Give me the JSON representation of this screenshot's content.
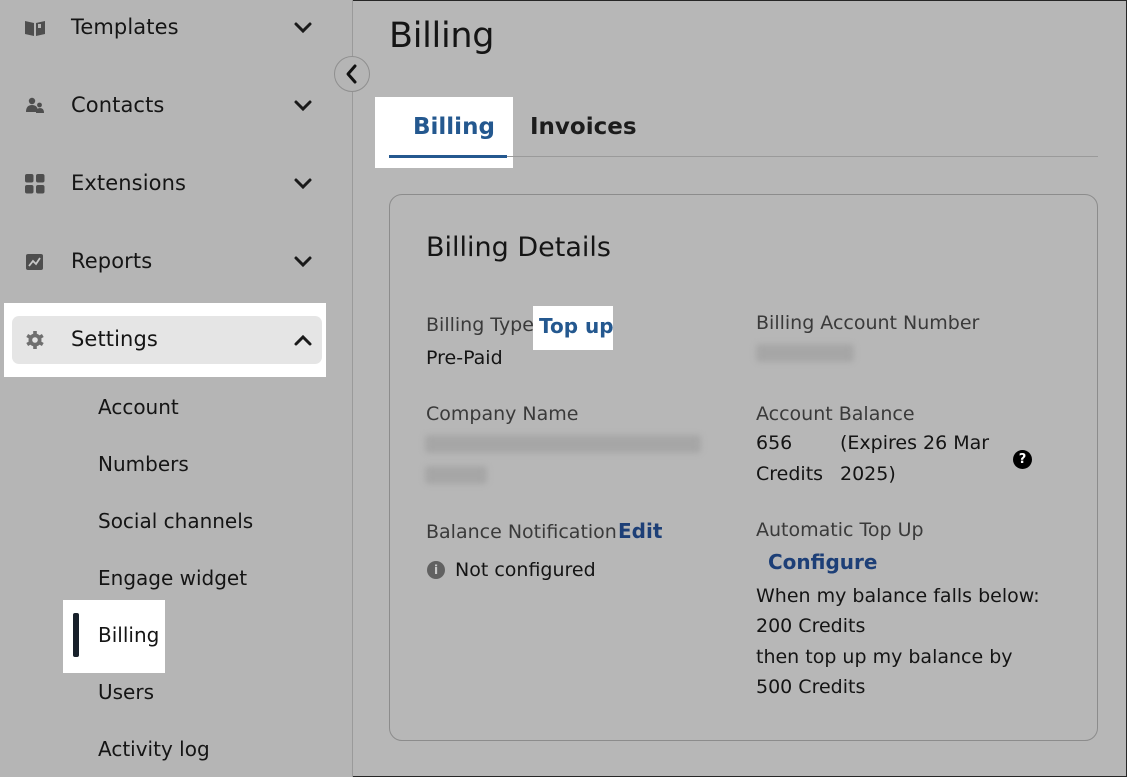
{
  "sidebar": {
    "items": [
      {
        "label": "Templates",
        "icon": "book-icon",
        "expanded": false
      },
      {
        "label": "Contacts",
        "icon": "people-icon",
        "expanded": false
      },
      {
        "label": "Extensions",
        "icon": "grid-icon",
        "expanded": false
      },
      {
        "label": "Reports",
        "icon": "chart-icon",
        "expanded": false
      },
      {
        "label": "Settings",
        "icon": "gear-icon",
        "expanded": true
      }
    ],
    "settings_children": [
      {
        "label": "Account"
      },
      {
        "label": "Numbers"
      },
      {
        "label": "Social channels"
      },
      {
        "label": "Engage widget"
      },
      {
        "label": "Billing",
        "active": true
      },
      {
        "label": "Users"
      },
      {
        "label": "Activity log"
      }
    ]
  },
  "header": {
    "title": "Billing",
    "tabs": [
      {
        "label": "Billing",
        "active": true
      },
      {
        "label": "Invoices",
        "active": false
      }
    ]
  },
  "billing_details": {
    "title": "Billing Details",
    "billing_type": {
      "label": "Billing Type",
      "action": "Top up",
      "value": "Pre-Paid"
    },
    "account_number": {
      "label": "Billing Account Number",
      "value_redacted": true
    },
    "company_name": {
      "label": "Company Name",
      "value_redacted": true
    },
    "account_balance": {
      "label": "Account Balance",
      "amount": "656",
      "unit": "Credits",
      "expiry_line1": "(Expires 26 Mar",
      "expiry_line2": "2025)"
    },
    "balance_notification": {
      "label": "Balance Notification",
      "action": "Edit",
      "status": "Not configured"
    },
    "automatic_top_up": {
      "label": "Automatic Top Up",
      "action": "Configure",
      "line1": "When my balance falls below:",
      "line2": "200 Credits",
      "line3": "then top up my balance by",
      "line4": "500 Credits"
    }
  },
  "colors": {
    "accent": "#24588f",
    "link_dark": "#1d3f77",
    "background": "#b7b7b7",
    "highlight": "#ffffff"
  }
}
